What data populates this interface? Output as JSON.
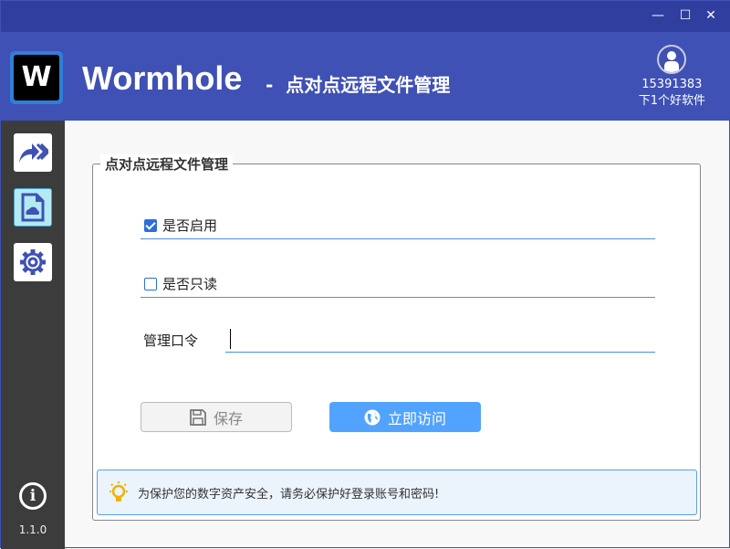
{
  "window": {
    "minimize": "—",
    "maximize": "☐",
    "close": "✕"
  },
  "header": {
    "logo_text": "W",
    "app_name": "Wormhole",
    "separator": "-",
    "subtitle": "点对点远程文件管理",
    "user_id": "15391383",
    "user_name": "下1个好软件"
  },
  "sidebar": {
    "items": [
      {
        "name": "transfer",
        "active": false
      },
      {
        "name": "file-cloud",
        "active": true
      },
      {
        "name": "settings",
        "active": false
      }
    ],
    "version": "1.1.0"
  },
  "main": {
    "group_title": "点对点远程文件管理",
    "enable": {
      "label": "是否启用",
      "checked": true
    },
    "readonly": {
      "label": "是否只读",
      "checked": false
    },
    "password": {
      "label": "管理口令",
      "value": ""
    },
    "save_label": "保存",
    "visit_label": "立即访问",
    "tip": "为保护您的数字资产安全，请务必保护好登录账号和密码!"
  },
  "colors": {
    "header": "#3f51b5",
    "titlebar": "#2f3e9f",
    "accent": "#52a3ff",
    "sidebar": "#3c3c3c"
  }
}
